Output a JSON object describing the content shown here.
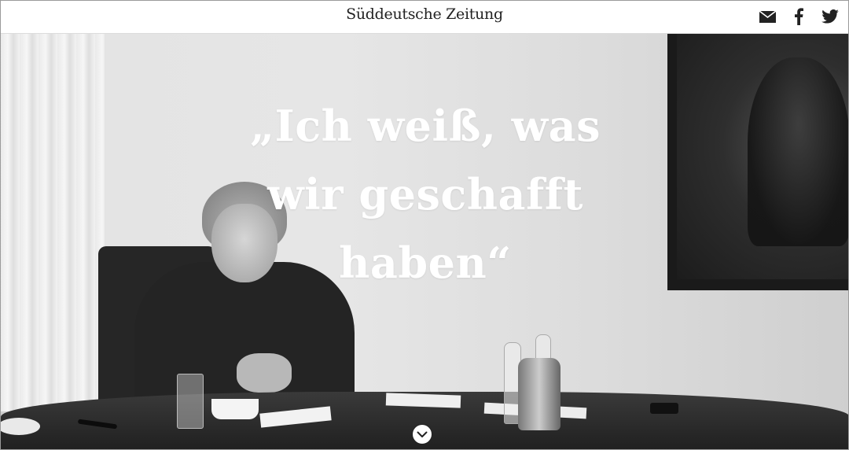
{
  "header": {
    "logo": "Süddeutsche Zeitung",
    "share": [
      {
        "icon": "mail-icon",
        "label": "E-Mail"
      },
      {
        "icon": "facebook-icon",
        "label": "Facebook"
      },
      {
        "icon": "twitter-icon",
        "label": "Twitter"
      }
    ]
  },
  "hero": {
    "headline_lines": [
      "„Ich weiß, was",
      "wir geschafft",
      "haben“"
    ],
    "scroll_icon": "chevron-down-icon"
  },
  "colors": {
    "headline": "#ffffff",
    "header_bg": "#ffffff",
    "icon": "#222222"
  }
}
